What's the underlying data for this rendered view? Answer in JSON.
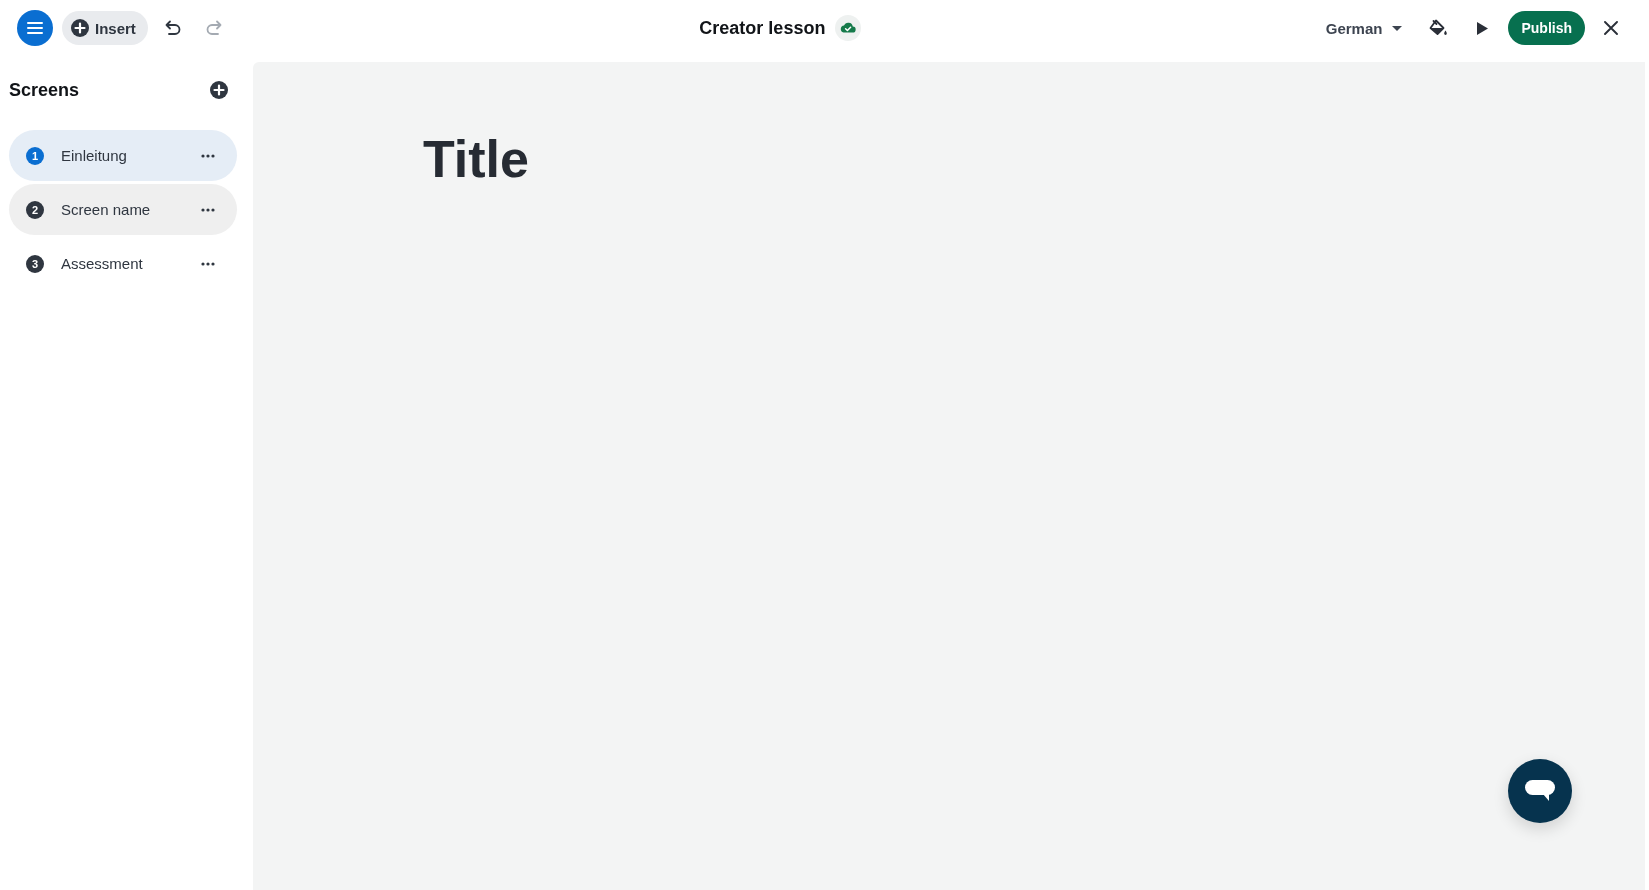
{
  "top_bar": {
    "insert_button": "Insert",
    "history": [
      {
        "kind": "undo",
        "disabled": false
      },
      {
        "kind": "redo",
        "disabled": true
      }
    ],
    "title": "Creator lesson",
    "language": "German",
    "publish_button": "Publish"
  },
  "sidebar": {
    "title": "Screens",
    "items": [
      {
        "number": "1",
        "label": "Einleitung",
        "selected": true,
        "hovered": false
      },
      {
        "number": "2",
        "label": "Screen name",
        "selected": false,
        "hovered": true
      },
      {
        "number": "3",
        "label": "Assessment",
        "selected": false,
        "hovered": false
      }
    ]
  },
  "canvas": {
    "title": "Title"
  }
}
